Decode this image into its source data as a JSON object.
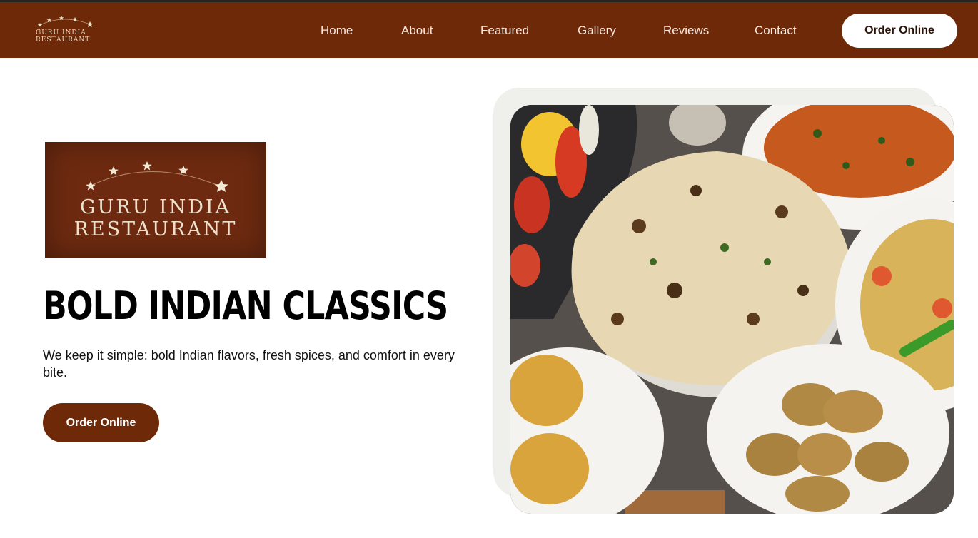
{
  "nav": {
    "logo_text": "GURU INDIA\nRESTAURANT",
    "links": [
      "Home",
      "About",
      "Featured",
      "Gallery",
      "Reviews",
      "Contact"
    ],
    "cta_label": "Order Online"
  },
  "hero": {
    "logo_text": "GURU INDIA\nRESTAURANT",
    "title": "BOLD INDIAN CLASSICS",
    "subtitle": "We keep it simple: bold Indian flavors, fresh spices, and comfort in every bite.",
    "cta_label": "Order Online"
  },
  "colors": {
    "brand": "#6d2908",
    "nav_text": "#fbe9df"
  }
}
